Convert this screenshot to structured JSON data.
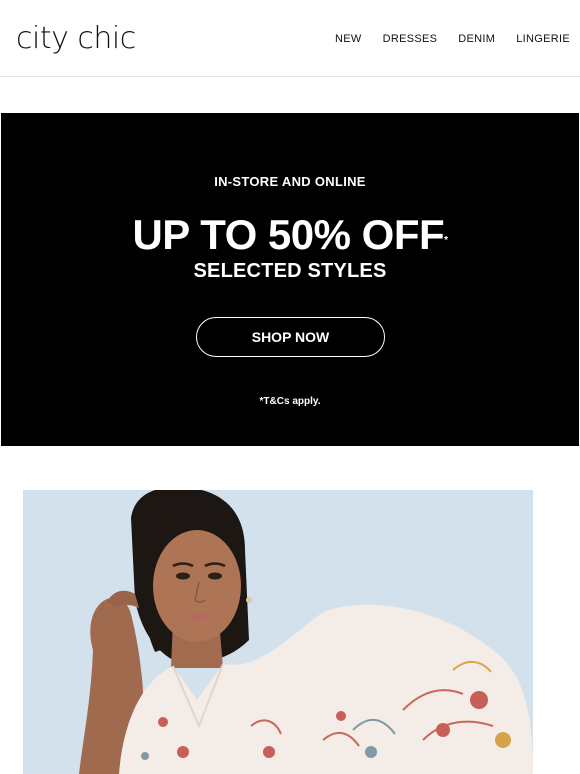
{
  "brand": {
    "logo_text": "city chic"
  },
  "nav": {
    "items": [
      "NEW",
      "DRESSES",
      "DENIM",
      "LINGERIE"
    ]
  },
  "promo": {
    "eyebrow": "IN-STORE AND ONLINE",
    "headline": "UP TO 50% OFF",
    "headline_mark": "*",
    "subline": "SELECTED STYLES",
    "cta_label": "SHOP NOW",
    "terms": "*T&Cs apply."
  },
  "hero": {
    "image_subject": "model in white floral embroidered blouse"
  },
  "colors": {
    "banner_bg": "#000000",
    "banner_text": "#ffffff",
    "hero_bg": "#d4e2ed"
  }
}
